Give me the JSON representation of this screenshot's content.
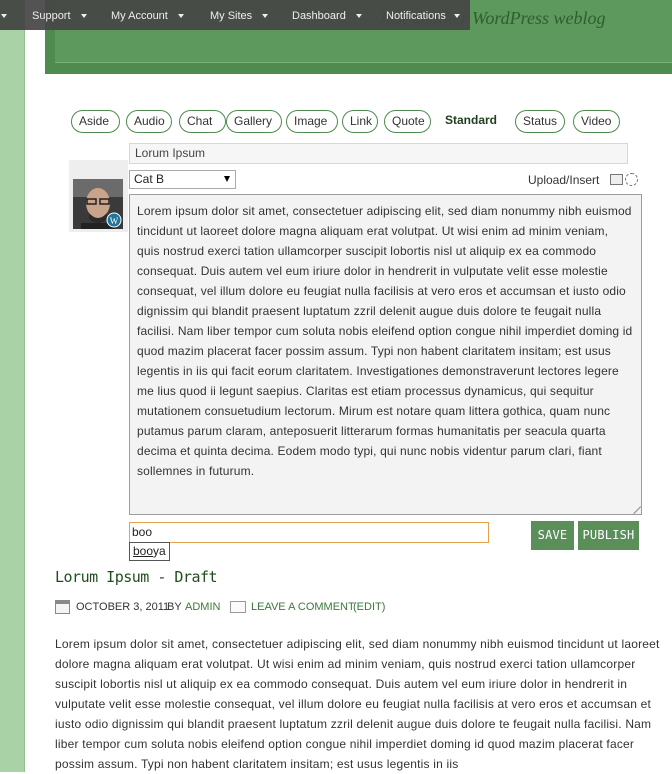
{
  "header": {
    "tagline": "Just another WordPress weblog"
  },
  "adminbar": {
    "items": [
      "Support",
      "My Account",
      "My Sites",
      "Dashboard",
      "Notifications"
    ]
  },
  "formats": [
    "Aside",
    "Audio",
    "Chat",
    "Gallery",
    "Image",
    "Link",
    "Quote",
    "Standard",
    "Status",
    "Video"
  ],
  "editor": {
    "title_value": "Lorum Ipsum",
    "category_value": "Cat B",
    "upload_label": "Upload/Insert",
    "content": "Lorem ipsum dolor sit amet, consectetuer adipiscing elit, sed diam nonummy nibh euismod tincidunt ut laoreet dolore magna aliquam erat volutpat. Ut wisi enim ad minim veniam, quis nostrud exerci tation ullamcorper suscipit lobortis nisl ut aliquip ex ea commodo consequat. Duis autem vel eum iriure dolor in hendrerit in vulputate velit esse molestie consequat, vel illum dolore eu feugiat nulla facilisis at vero eros et accumsan et iusto odio dignissim qui blandit praesent luptatum zzril delenit augue duis dolore te feugait nulla facilisi. Nam liber tempor cum soluta nobis eleifend option congue nihil imperdiet doming id quod mazim placerat facer possim assum. Typi non habent claritatem insitam; est usus legentis in iis qui facit eorum claritatem. Investigationes demonstraverunt lectores legere me lius quod ii legunt saepius. Claritas est etiam processus dynamicus, qui sequitur mutationem consuetudium lectorum. Mirum est notare quam littera gothica, quam nunc putamus parum claram, anteposuerit litterarum formas humanitatis per seacula quarta decima et quinta decima. Eodem modo typi, qui nunc nobis videntur parum clari, fiant sollemnes in futurum.",
    "tags_value": "boo",
    "suggestion_match": "boo",
    "suggestion_rest": "ya",
    "save_label": "SAVE",
    "publish_label": "PUBLISH"
  },
  "post": {
    "title": "Lorum Ipsum - Draft",
    "date": "OCTOBER 3, 2011",
    "by": "BY",
    "author": "ADMIN",
    "comment_link": "LEAVE A COMMENT",
    "edit_link": "(EDIT)",
    "body": "Lorem ipsum dolor sit amet, consectetuer adipiscing elit, sed diam nonummy nibh euismod tincidunt ut laoreet dolore magna aliquam erat volutpat. Ut wisi enim ad minim veniam, quis nostrud exerci tation ullamcorper suscipit lobortis nisl ut aliquip ex ea commodo consequat. Duis autem vel eum iriure dolor in hendrerit in vulputate velit esse molestie consequat, vel illum dolore eu feugiat nulla facilisis at vero eros et accumsan et iusto odio dignissim qui blandit praesent luptatum zzril delenit augue duis dolore te feugait nulla facilisi. Nam liber tempor cum soluta nobis eleifend option congue nihil imperdiet doming id quod mazim placerat facer possim assum. Typi non habent claritatem insitam; est usus legentis in iis"
  },
  "colors": {
    "header_green": "#4f8a4f",
    "button_green": "#5a8f5a",
    "stripe_green": "#a9d3a6",
    "adminbar": "#464646"
  }
}
